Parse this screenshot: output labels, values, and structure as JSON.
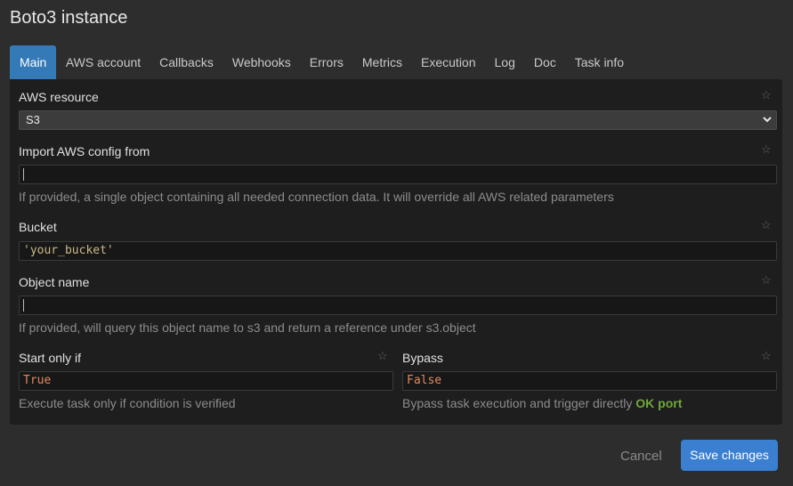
{
  "modal": {
    "title": "Boto3 instance"
  },
  "tabs": [
    {
      "label": "Main"
    },
    {
      "label": "AWS account"
    },
    {
      "label": "Callbacks"
    },
    {
      "label": "Webhooks"
    },
    {
      "label": "Errors"
    },
    {
      "label": "Metrics"
    },
    {
      "label": "Execution"
    },
    {
      "label": "Log"
    },
    {
      "label": "Doc"
    },
    {
      "label": "Task info"
    }
  ],
  "form": {
    "aws_resource": {
      "label": "AWS resource",
      "value": "S3"
    },
    "import_config": {
      "label": "Import AWS config from",
      "value": "",
      "help": "If provided, a single object containing all needed connection data. It will override all AWS related parameters"
    },
    "bucket": {
      "label": "Bucket",
      "value": "'your_bucket'"
    },
    "object_name": {
      "label": "Object name",
      "value": "",
      "help": "If provided, will query this object name to s3 and return a reference under s3.object"
    },
    "start_only_if": {
      "label": "Start only if",
      "value": "True",
      "help": "Execute task only if condition is verified"
    },
    "bypass": {
      "label": "Bypass",
      "value": "False",
      "help": "Bypass task execution and trigger directly",
      "help_highlight": "OK port"
    }
  },
  "footer": {
    "cancel_label": "Cancel",
    "save_label": "Save changes"
  },
  "colors": {
    "accent": "#337ab7",
    "save_button": "#3a7fd0",
    "ok_port": "#6fa83a",
    "string_literal": "#c9b784",
    "keyword": "#e08a60"
  }
}
